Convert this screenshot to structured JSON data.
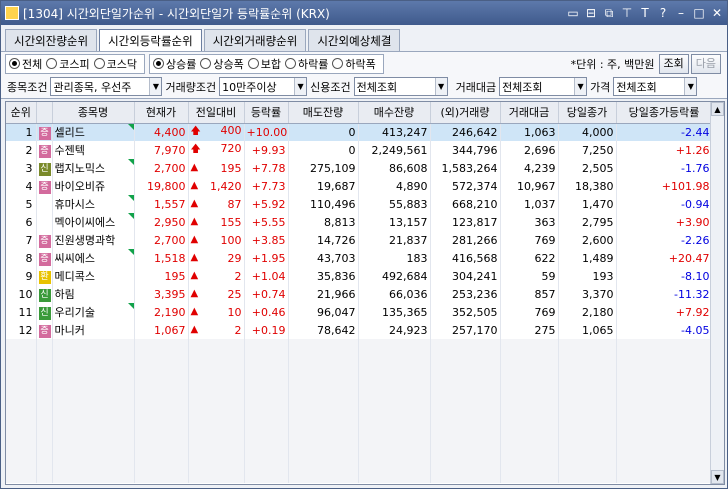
{
  "window": {
    "title": "[1304] 시간외단일가순위 - 시간외단일가 등락률순위 (KRX)",
    "buttons": [
      "□",
      "⊟",
      "◫",
      "∓",
      "T",
      "?",
      "–",
      "□",
      "✕"
    ]
  },
  "tabs": [
    {
      "label": "시간외잔량순위",
      "active": false
    },
    {
      "label": "시간외등락률순위",
      "active": true
    },
    {
      "label": "시간외거래량순위",
      "active": false
    },
    {
      "label": "시간외예상체결",
      "active": false
    }
  ],
  "market_radios": [
    {
      "label": "전체",
      "selected": true
    },
    {
      "label": "코스피",
      "selected": false
    },
    {
      "label": "코스닥",
      "selected": false
    }
  ],
  "rank_radios": [
    {
      "label": "상승률",
      "selected": true
    },
    {
      "label": "상승폭",
      "selected": false
    },
    {
      "label": "보합",
      "selected": false
    },
    {
      "label": "하락률",
      "selected": false
    },
    {
      "label": "하락폭",
      "selected": false
    }
  ],
  "unit_label": "*단위 : 주, 백만원",
  "query_button": "조회",
  "next_button": "다음",
  "filters": {
    "stock_cond_label": "종목조건",
    "stock_cond_value": "관리종목, 우선주",
    "volume_cond_label": "거래량조건",
    "volume_cond_value": "10만주이상",
    "credit_cond_label": "신용조건",
    "credit_cond_value": "전체조회",
    "amount_label": "거래대금",
    "amount_value": "전체조회",
    "price_label": "가격",
    "price_value": "전체조회"
  },
  "columns": [
    "순위",
    "",
    "종목명",
    "현재가",
    "전일대비",
    "등락률",
    "매도잔량",
    "매수잔량",
    "(외)거래량",
    "거래대금",
    "당일종가",
    "당일종가등락률"
  ],
  "rows": [
    {
      "rank": "1",
      "badge": "증",
      "badge_color": "#d36b9d",
      "name": "셀리드",
      "price": "4,400",
      "dir": "up2",
      "change": "400",
      "rate": "+10.00",
      "sell": "0",
      "buy": "413,247",
      "volume": "246,642",
      "amount": "1,063",
      "close": "4,000",
      "close_rate": "-2.44",
      "close_dir": "down",
      "tri": true
    },
    {
      "rank": "2",
      "badge": "증",
      "badge_color": "#d36b9d",
      "name": "수젠텍",
      "price": "7,970",
      "dir": "up2",
      "change": "720",
      "rate": "+9.93",
      "sell": "0",
      "buy": "2,249,561",
      "volume": "344,796",
      "amount": "2,696",
      "close": "7,250",
      "close_rate": "+1.26",
      "close_dir": "up",
      "tri": false
    },
    {
      "rank": "3",
      "badge": "신",
      "badge_color": "#7a8a2a",
      "name": "랩지노믹스",
      "price": "2,700",
      "dir": "up",
      "change": "195",
      "rate": "+7.78",
      "sell": "275,109",
      "buy": "86,608",
      "volume": "1,583,264",
      "amount": "4,239",
      "close": "2,505",
      "close_rate": "-1.76",
      "close_dir": "down",
      "tri": true
    },
    {
      "rank": "4",
      "badge": "증",
      "badge_color": "#d36b9d",
      "name": "바이오비쥬",
      "price": "19,800",
      "dir": "up",
      "change": "1,420",
      "rate": "+7.73",
      "sell": "19,687",
      "buy": "4,890",
      "volume": "572,374",
      "amount": "10,967",
      "close": "18,380",
      "close_rate": "+101.98",
      "close_dir": "up",
      "tri": false
    },
    {
      "rank": "5",
      "badge": "",
      "badge_color": "",
      "name": "휴마시스",
      "price": "1,557",
      "dir": "up",
      "change": "87",
      "rate": "+5.92",
      "sell": "110,496",
      "buy": "55,883",
      "volume": "668,210",
      "amount": "1,037",
      "close": "1,470",
      "close_rate": "-0.94",
      "close_dir": "down",
      "tri": true
    },
    {
      "rank": "6",
      "badge": "",
      "badge_color": "",
      "name": "멕아이씨에스",
      "price": "2,950",
      "dir": "up",
      "change": "155",
      "rate": "+5.55",
      "sell": "8,813",
      "buy": "13,157",
      "volume": "123,817",
      "amount": "363",
      "close": "2,795",
      "close_rate": "+3.90",
      "close_dir": "up",
      "tri": true
    },
    {
      "rank": "7",
      "badge": "증",
      "badge_color": "#d36b9d",
      "name": "진원생명과학",
      "price": "2,700",
      "dir": "up",
      "change": "100",
      "rate": "+3.85",
      "sell": "14,726",
      "buy": "21,837",
      "volume": "281,266",
      "amount": "769",
      "close": "2,600",
      "close_rate": "-2.26",
      "close_dir": "down",
      "tri": false
    },
    {
      "rank": "8",
      "badge": "증",
      "badge_color": "#d36b9d",
      "name": "씨씨에스",
      "price": "1,518",
      "dir": "up",
      "change": "29",
      "rate": "+1.95",
      "sell": "43,703",
      "buy": "183",
      "volume": "416,568",
      "amount": "622",
      "close": "1,489",
      "close_rate": "+20.47",
      "close_dir": "up",
      "tri": true
    },
    {
      "rank": "9",
      "badge": "환",
      "badge_color": "#e8c200",
      "name": "메디콕스",
      "price": "195",
      "dir": "up",
      "change": "2",
      "rate": "+1.04",
      "sell": "35,836",
      "buy": "492,684",
      "volume": "304,241",
      "amount": "59",
      "close": "193",
      "close_rate": "-8.10",
      "close_dir": "down",
      "tri": false
    },
    {
      "rank": "10",
      "badge": "신",
      "badge_color": "#3a9a3a",
      "name": "하림",
      "price": "3,395",
      "dir": "up",
      "change": "25",
      "rate": "+0.74",
      "sell": "21,966",
      "buy": "66,036",
      "volume": "253,236",
      "amount": "857",
      "close": "3,370",
      "close_rate": "-11.32",
      "close_dir": "down",
      "tri": false
    },
    {
      "rank": "11",
      "badge": "신",
      "badge_color": "#3a9a3a",
      "name": "우리기술",
      "price": "2,190",
      "dir": "up",
      "change": "10",
      "rate": "+0.46",
      "sell": "96,047",
      "buy": "135,365",
      "volume": "352,505",
      "amount": "769",
      "close": "2,180",
      "close_rate": "+7.92",
      "close_dir": "up",
      "tri": true
    },
    {
      "rank": "12",
      "badge": "증",
      "badge_color": "#d36b9d",
      "name": "마니커",
      "price": "1,067",
      "dir": "up",
      "change": "2",
      "rate": "+0.19",
      "sell": "78,642",
      "buy": "24,923",
      "volume": "257,170",
      "amount": "275",
      "close": "1,065",
      "close_rate": "-4.05",
      "close_dir": "down",
      "tri": false
    }
  ]
}
